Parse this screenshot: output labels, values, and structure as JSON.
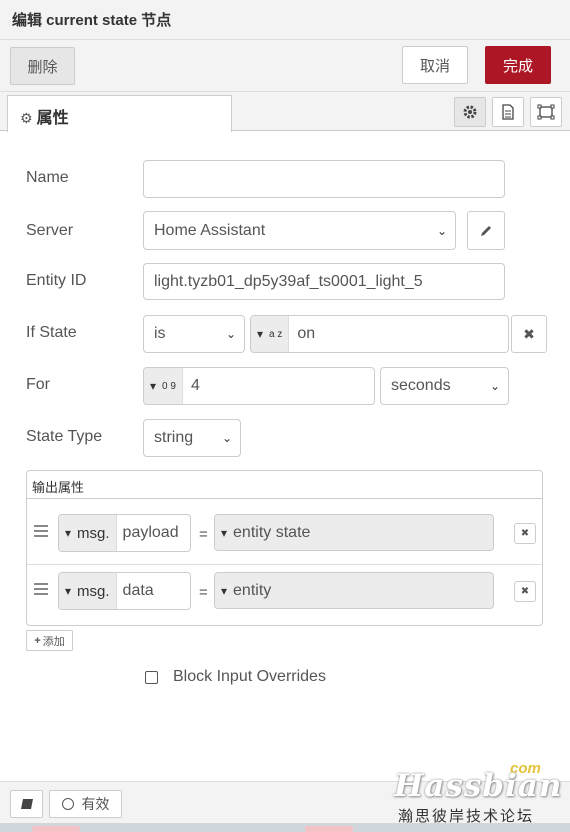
{
  "title": "编辑 current state 节点",
  "toolbar": {
    "delete_label": "删除",
    "cancel_label": "取消",
    "done_label": "完成"
  },
  "tab": {
    "label": "属性",
    "icons": [
      "gear-icon",
      "document-icon",
      "frame-icon"
    ]
  },
  "form": {
    "name_label": "Name",
    "name_value": "",
    "server_label": "Server",
    "server_value": "Home Assistant",
    "entity_label": "Entity ID",
    "entity_value": "light.tyzb01_dp5y39af_ts0001_light_5",
    "ifstate_label": "If State",
    "ifstate_operator": "is",
    "ifstate_type_glyph": "a z",
    "ifstate_value": "on",
    "for_label": "For",
    "for_type_glyph": "0 9",
    "for_value": "4",
    "for_unit": "seconds",
    "statetype_label": "State Type",
    "statetype_value": "string"
  },
  "output": {
    "header": "输出属性",
    "rows": [
      {
        "prefix": "msg.",
        "property": "payload",
        "value": "entity state"
      },
      {
        "prefix": "msg.",
        "property": "data",
        "value": "entity"
      }
    ],
    "add_label": "添加"
  },
  "block_input": {
    "label": "Block Input Overrides",
    "checked": false
  },
  "footer": {
    "enabled_label": "有效"
  },
  "watermark": {
    "brand": "Hassbian",
    "tld": "com",
    "subtitle": "瀚思彼岸技术论坛"
  },
  "colors": {
    "primary": "#ad1625",
    "panel": "#f3f3f3",
    "border": "#cccccc"
  }
}
